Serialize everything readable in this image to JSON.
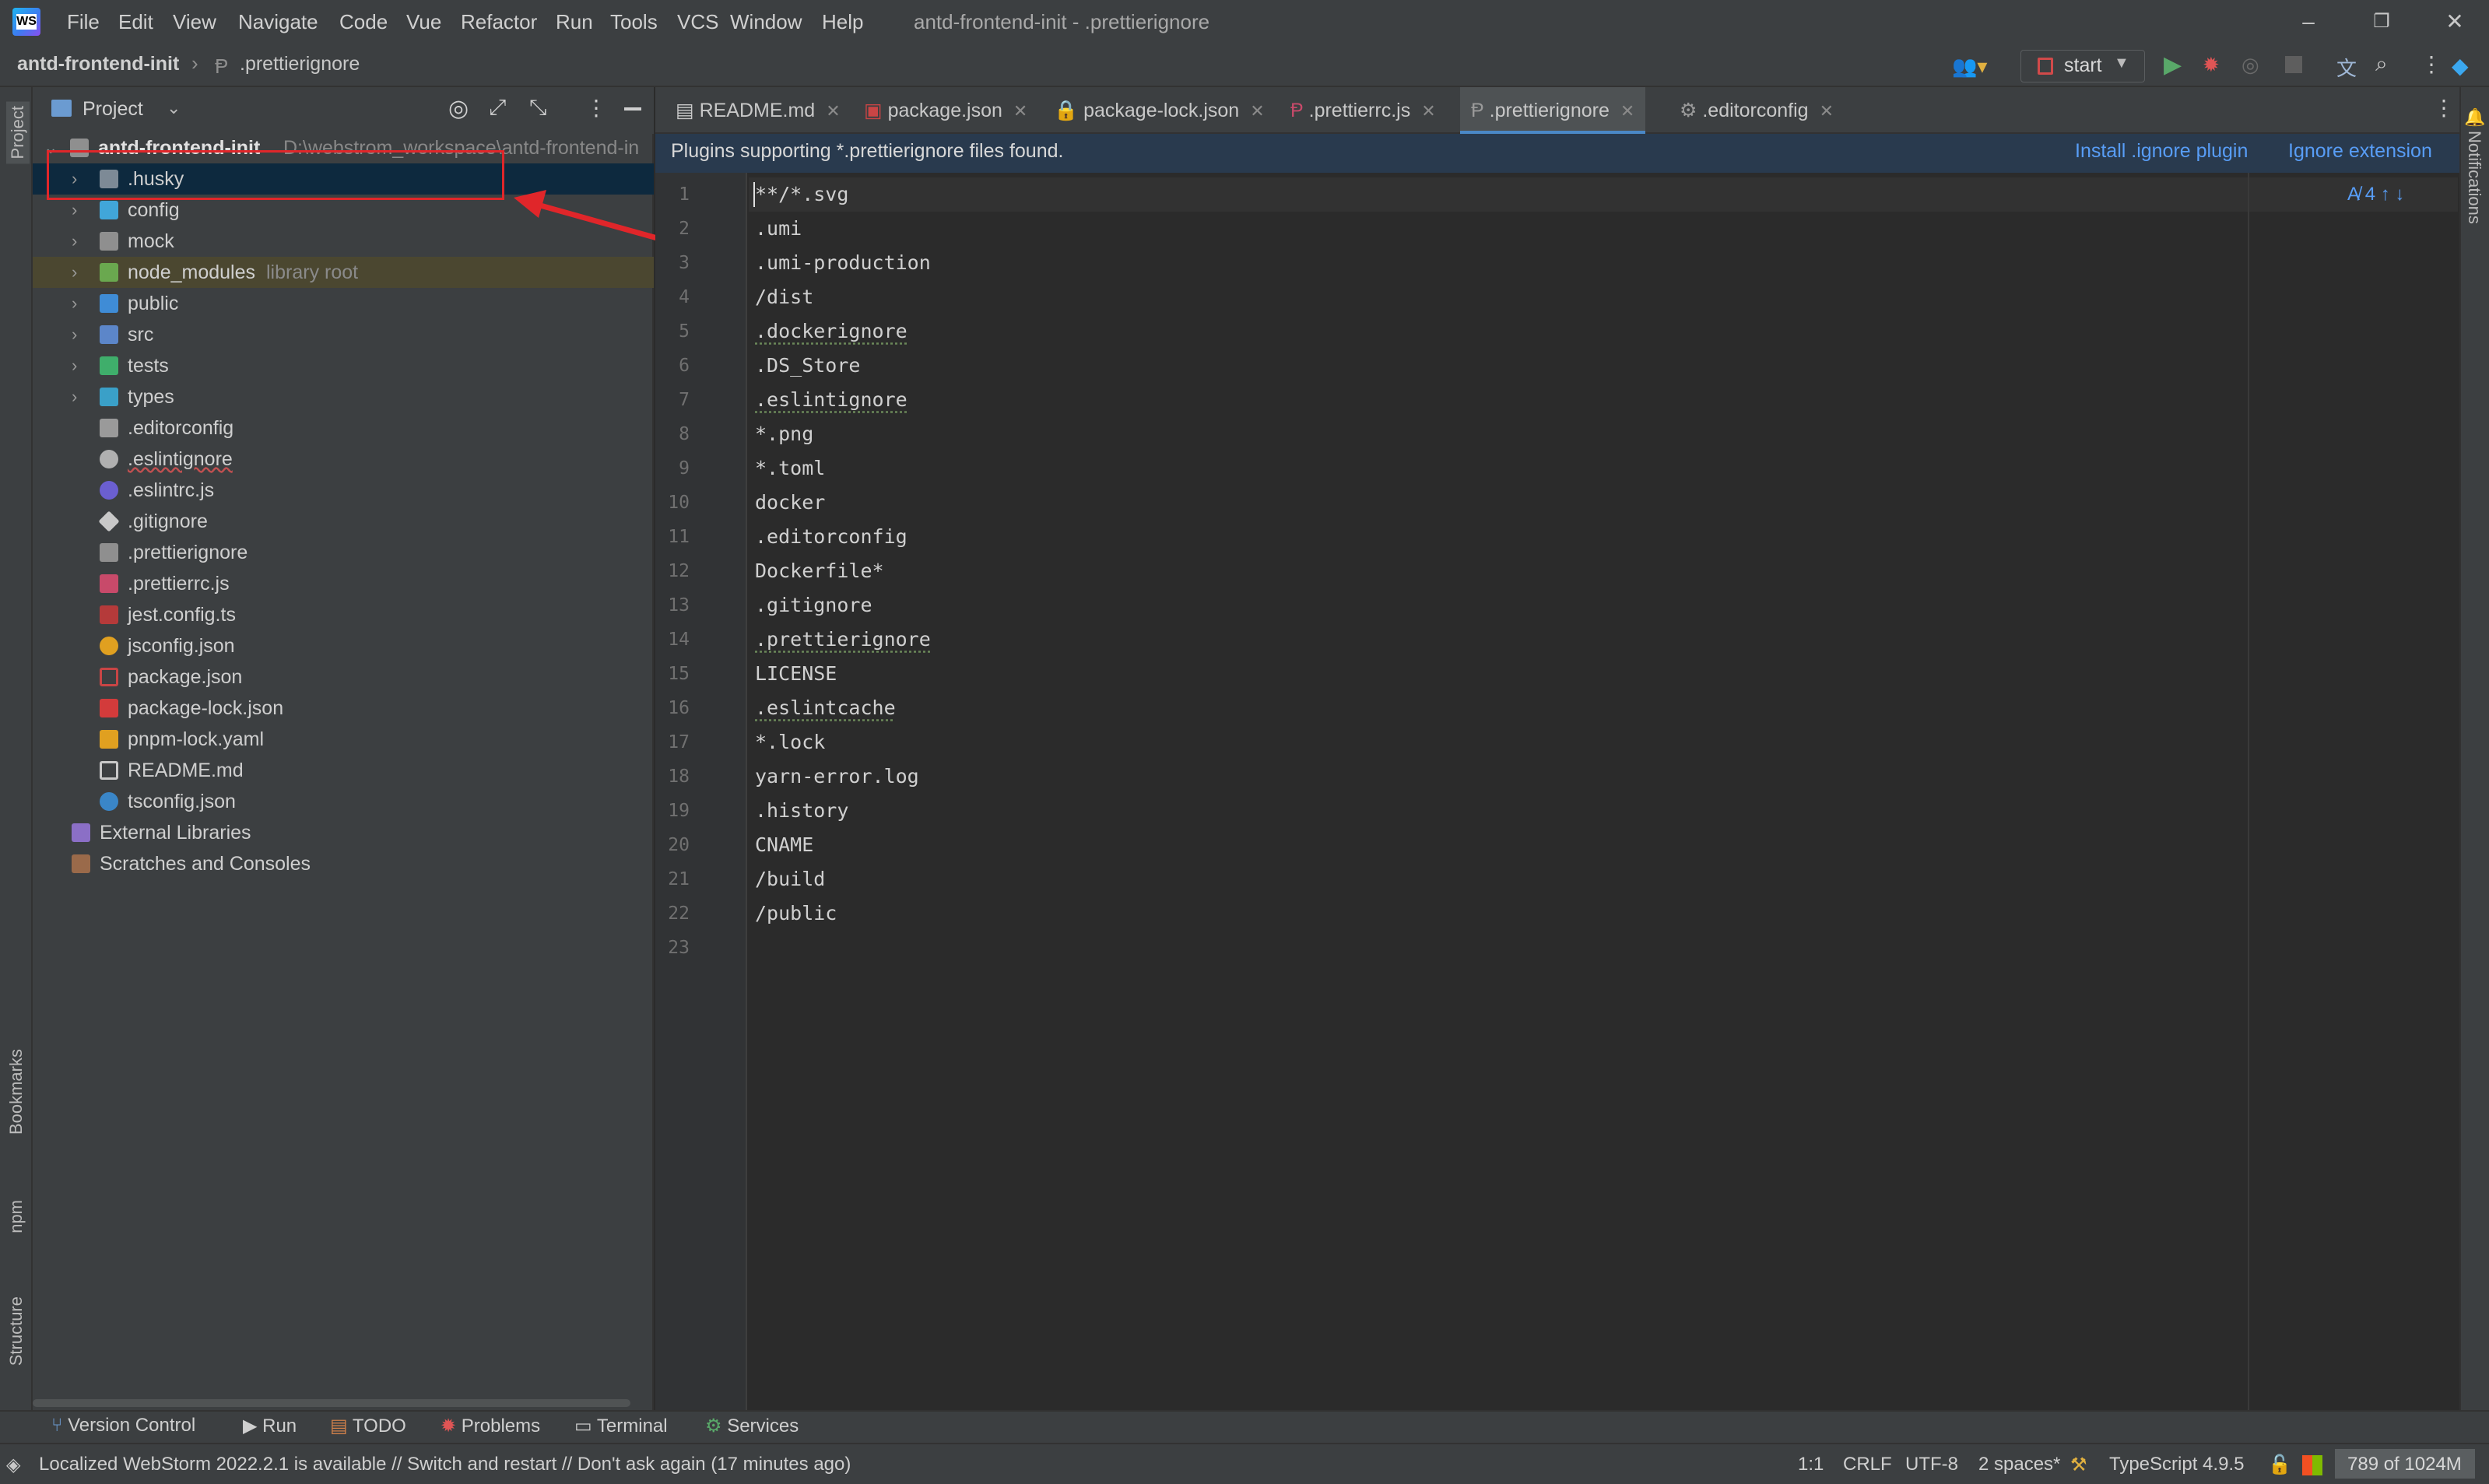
{
  "window": {
    "title": "antd-frontend-init - .prettierignore",
    "minimize": "–",
    "restore": "❐",
    "close": "✕"
  },
  "menu": [
    "File",
    "Edit",
    "View",
    "Navigate",
    "Code",
    "Vue",
    "Refactor",
    "Run",
    "Tools",
    "VCS",
    "Window",
    "Help"
  ],
  "breadcrumb": {
    "project": "antd-frontend-init",
    "separator": "›",
    "file": ".prettierignore"
  },
  "run_config": {
    "label": "start"
  },
  "left_strip": [
    "Project",
    "Bookmarks",
    "npm",
    "Structure"
  ],
  "right_strip": [
    "Notifications"
  ],
  "project_panel": {
    "title": "Project",
    "root": {
      "name": "antd-frontend-init",
      "path": "D:\\webstrom_workspace\\antd-frontend-in"
    },
    "items": [
      {
        "name": ".husky",
        "kind": "folder"
      },
      {
        "name": "config",
        "kind": "folder"
      },
      {
        "name": "mock",
        "kind": "folder"
      },
      {
        "name": "node_modules",
        "kind": "folder",
        "note": "library root"
      },
      {
        "name": "public",
        "kind": "folder"
      },
      {
        "name": "src",
        "kind": "folder"
      },
      {
        "name": "tests",
        "kind": "folder"
      },
      {
        "name": "types",
        "kind": "folder"
      },
      {
        "name": ".editorconfig",
        "kind": "file"
      },
      {
        "name": ".eslintignore",
        "kind": "file"
      },
      {
        "name": ".eslintrc.js",
        "kind": "file"
      },
      {
        "name": ".gitignore",
        "kind": "file"
      },
      {
        "name": ".prettierignore",
        "kind": "file"
      },
      {
        "name": ".prettierrc.js",
        "kind": "file"
      },
      {
        "name": "jest.config.ts",
        "kind": "file"
      },
      {
        "name": "jsconfig.json",
        "kind": "file"
      },
      {
        "name": "package.json",
        "kind": "file"
      },
      {
        "name": "package-lock.json",
        "kind": "file"
      },
      {
        "name": "pnpm-lock.yaml",
        "kind": "file"
      },
      {
        "name": "README.md",
        "kind": "file"
      },
      {
        "name": "tsconfig.json",
        "kind": "file"
      }
    ],
    "external_libraries": "External Libraries",
    "scratches": "Scratches and Consoles"
  },
  "tabs": [
    {
      "label": "README.md",
      "active": false
    },
    {
      "label": "package.json",
      "active": false
    },
    {
      "label": "package-lock.json",
      "active": false
    },
    {
      "label": ".prettierrc.js",
      "active": false
    },
    {
      "label": ".prettierignore",
      "active": true
    },
    {
      "label": ".editorconfig",
      "active": false
    }
  ],
  "banner": {
    "text": "Plugins supporting *.prettierignore files found.",
    "install_link": "Install .ignore plugin",
    "ignore_link": "Ignore extension"
  },
  "editor": {
    "inspections": "4",
    "lines": [
      "**/*.svg",
      ".umi",
      ".umi-production",
      "/dist",
      ".dockerignore",
      ".DS_Store",
      ".eslintignore",
      "*.png",
      "*.toml",
      "docker",
      ".editorconfig",
      "Dockerfile*",
      ".gitignore",
      ".prettierignore",
      "LICENSE",
      ".eslintcache",
      "*.lock",
      "yarn-error.log",
      ".history",
      "CNAME",
      "/build",
      "/public",
      ""
    ]
  },
  "tool_windows": [
    "Version Control",
    "Run",
    "TODO",
    "Problems",
    "Terminal",
    "Services"
  ],
  "status": {
    "message": "Localized WebStorm 2022.2.1 is available // Switch and restart // Don't ask again (17 minutes ago)",
    "position": "1:1",
    "line_sep": "CRLF",
    "encoding": "UTF-8",
    "indent": "2 spaces*",
    "language": "TypeScript 4.9.5",
    "memory": "789 of 1024M"
  },
  "colors": {
    "accent": "#589df6",
    "highlight_box": "#e0262a",
    "active_tab_border": "#4a88c7"
  }
}
